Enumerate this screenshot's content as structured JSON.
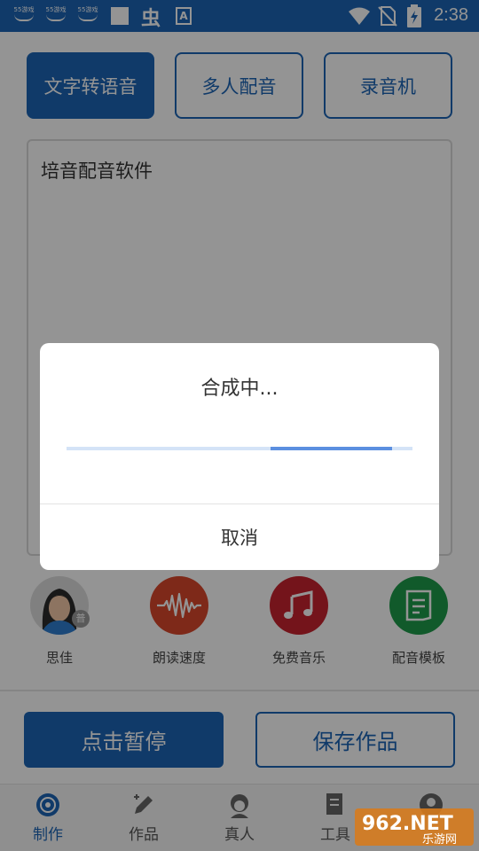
{
  "status_bar": {
    "app_icons": [
      "55游戏",
      "55游戏",
      "55游戏"
    ],
    "time": "2:38"
  },
  "modes": [
    {
      "label": "文字转语音",
      "active": true
    },
    {
      "label": "多人配音",
      "active": false
    },
    {
      "label": "录音机",
      "active": false
    }
  ],
  "editor": {
    "text": "培音配音软件"
  },
  "tools": [
    {
      "label": "思佳",
      "icon": "voice-avatar-icon",
      "badge": "普"
    },
    {
      "label": "朗读速度",
      "icon": "waveform-icon",
      "color": "#d9482b"
    },
    {
      "label": "免费音乐",
      "icon": "music-notes-icon",
      "color": "#c8242f"
    },
    {
      "label": "配音模板",
      "icon": "template-icon",
      "color": "#1e9b4a"
    }
  ],
  "actions": {
    "pause": "点击暂停",
    "save": "保存作品"
  },
  "tabs": [
    {
      "label": "制作",
      "icon": "disc-icon",
      "active": true
    },
    {
      "label": "作品",
      "icon": "pencil-icon",
      "active": false
    },
    {
      "label": "真人",
      "icon": "person-icon",
      "active": false
    },
    {
      "label": "工具",
      "icon": "tool-doc-icon",
      "active": false
    }
  ],
  "dialog": {
    "title": "合成中...",
    "progress_start": 0.59,
    "progress_end": 0.94,
    "cancel": "取消"
  },
  "watermark": {
    "text": "962.NET",
    "subtext": "乐游网"
  },
  "colors": {
    "primary": "#1c65b5",
    "progress": "#5b8fe0"
  }
}
